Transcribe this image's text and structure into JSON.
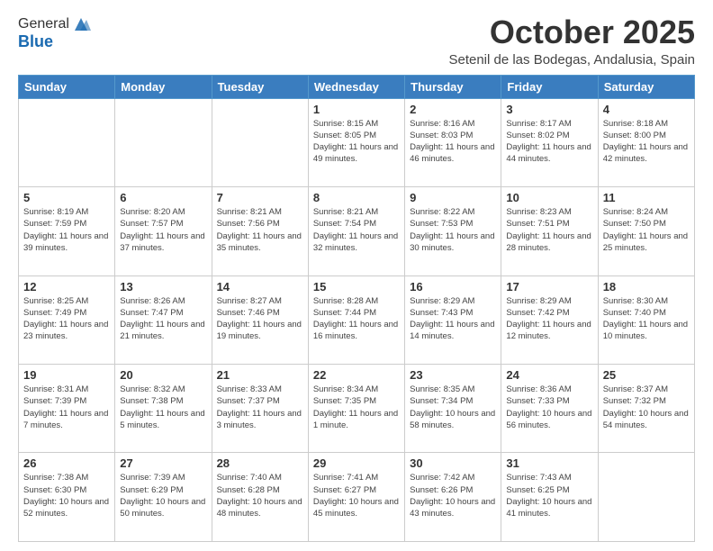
{
  "header": {
    "logo_general": "General",
    "logo_blue": "Blue",
    "month_title": "October 2025",
    "location": "Setenil de las Bodegas, Andalusia, Spain"
  },
  "weekdays": [
    "Sunday",
    "Monday",
    "Tuesday",
    "Wednesday",
    "Thursday",
    "Friday",
    "Saturday"
  ],
  "weeks": [
    [
      {
        "day": "",
        "info": ""
      },
      {
        "day": "",
        "info": ""
      },
      {
        "day": "",
        "info": ""
      },
      {
        "day": "1",
        "info": "Sunrise: 8:15 AM\nSunset: 8:05 PM\nDaylight: 11 hours\nand 49 minutes."
      },
      {
        "day": "2",
        "info": "Sunrise: 8:16 AM\nSunset: 8:03 PM\nDaylight: 11 hours\nand 46 minutes."
      },
      {
        "day": "3",
        "info": "Sunrise: 8:17 AM\nSunset: 8:02 PM\nDaylight: 11 hours\nand 44 minutes."
      },
      {
        "day": "4",
        "info": "Sunrise: 8:18 AM\nSunset: 8:00 PM\nDaylight: 11 hours\nand 42 minutes."
      }
    ],
    [
      {
        "day": "5",
        "info": "Sunrise: 8:19 AM\nSunset: 7:59 PM\nDaylight: 11 hours\nand 39 minutes."
      },
      {
        "day": "6",
        "info": "Sunrise: 8:20 AM\nSunset: 7:57 PM\nDaylight: 11 hours\nand 37 minutes."
      },
      {
        "day": "7",
        "info": "Sunrise: 8:21 AM\nSunset: 7:56 PM\nDaylight: 11 hours\nand 35 minutes."
      },
      {
        "day": "8",
        "info": "Sunrise: 8:21 AM\nSunset: 7:54 PM\nDaylight: 11 hours\nand 32 minutes."
      },
      {
        "day": "9",
        "info": "Sunrise: 8:22 AM\nSunset: 7:53 PM\nDaylight: 11 hours\nand 30 minutes."
      },
      {
        "day": "10",
        "info": "Sunrise: 8:23 AM\nSunset: 7:51 PM\nDaylight: 11 hours\nand 28 minutes."
      },
      {
        "day": "11",
        "info": "Sunrise: 8:24 AM\nSunset: 7:50 PM\nDaylight: 11 hours\nand 25 minutes."
      }
    ],
    [
      {
        "day": "12",
        "info": "Sunrise: 8:25 AM\nSunset: 7:49 PM\nDaylight: 11 hours\nand 23 minutes."
      },
      {
        "day": "13",
        "info": "Sunrise: 8:26 AM\nSunset: 7:47 PM\nDaylight: 11 hours\nand 21 minutes."
      },
      {
        "day": "14",
        "info": "Sunrise: 8:27 AM\nSunset: 7:46 PM\nDaylight: 11 hours\nand 19 minutes."
      },
      {
        "day": "15",
        "info": "Sunrise: 8:28 AM\nSunset: 7:44 PM\nDaylight: 11 hours\nand 16 minutes."
      },
      {
        "day": "16",
        "info": "Sunrise: 8:29 AM\nSunset: 7:43 PM\nDaylight: 11 hours\nand 14 minutes."
      },
      {
        "day": "17",
        "info": "Sunrise: 8:29 AM\nSunset: 7:42 PM\nDaylight: 11 hours\nand 12 minutes."
      },
      {
        "day": "18",
        "info": "Sunrise: 8:30 AM\nSunset: 7:40 PM\nDaylight: 11 hours\nand 10 minutes."
      }
    ],
    [
      {
        "day": "19",
        "info": "Sunrise: 8:31 AM\nSunset: 7:39 PM\nDaylight: 11 hours\nand 7 minutes."
      },
      {
        "day": "20",
        "info": "Sunrise: 8:32 AM\nSunset: 7:38 PM\nDaylight: 11 hours\nand 5 minutes."
      },
      {
        "day": "21",
        "info": "Sunrise: 8:33 AM\nSunset: 7:37 PM\nDaylight: 11 hours\nand 3 minutes."
      },
      {
        "day": "22",
        "info": "Sunrise: 8:34 AM\nSunset: 7:35 PM\nDaylight: 11 hours\nand 1 minute."
      },
      {
        "day": "23",
        "info": "Sunrise: 8:35 AM\nSunset: 7:34 PM\nDaylight: 10 hours\nand 58 minutes."
      },
      {
        "day": "24",
        "info": "Sunrise: 8:36 AM\nSunset: 7:33 PM\nDaylight: 10 hours\nand 56 minutes."
      },
      {
        "day": "25",
        "info": "Sunrise: 8:37 AM\nSunset: 7:32 PM\nDaylight: 10 hours\nand 54 minutes."
      }
    ],
    [
      {
        "day": "26",
        "info": "Sunrise: 7:38 AM\nSunset: 6:30 PM\nDaylight: 10 hours\nand 52 minutes."
      },
      {
        "day": "27",
        "info": "Sunrise: 7:39 AM\nSunset: 6:29 PM\nDaylight: 10 hours\nand 50 minutes."
      },
      {
        "day": "28",
        "info": "Sunrise: 7:40 AM\nSunset: 6:28 PM\nDaylight: 10 hours\nand 48 minutes."
      },
      {
        "day": "29",
        "info": "Sunrise: 7:41 AM\nSunset: 6:27 PM\nDaylight: 10 hours\nand 45 minutes."
      },
      {
        "day": "30",
        "info": "Sunrise: 7:42 AM\nSunset: 6:26 PM\nDaylight: 10 hours\nand 43 minutes."
      },
      {
        "day": "31",
        "info": "Sunrise: 7:43 AM\nSunset: 6:25 PM\nDaylight: 10 hours\nand 41 minutes."
      },
      {
        "day": "",
        "info": ""
      }
    ]
  ]
}
